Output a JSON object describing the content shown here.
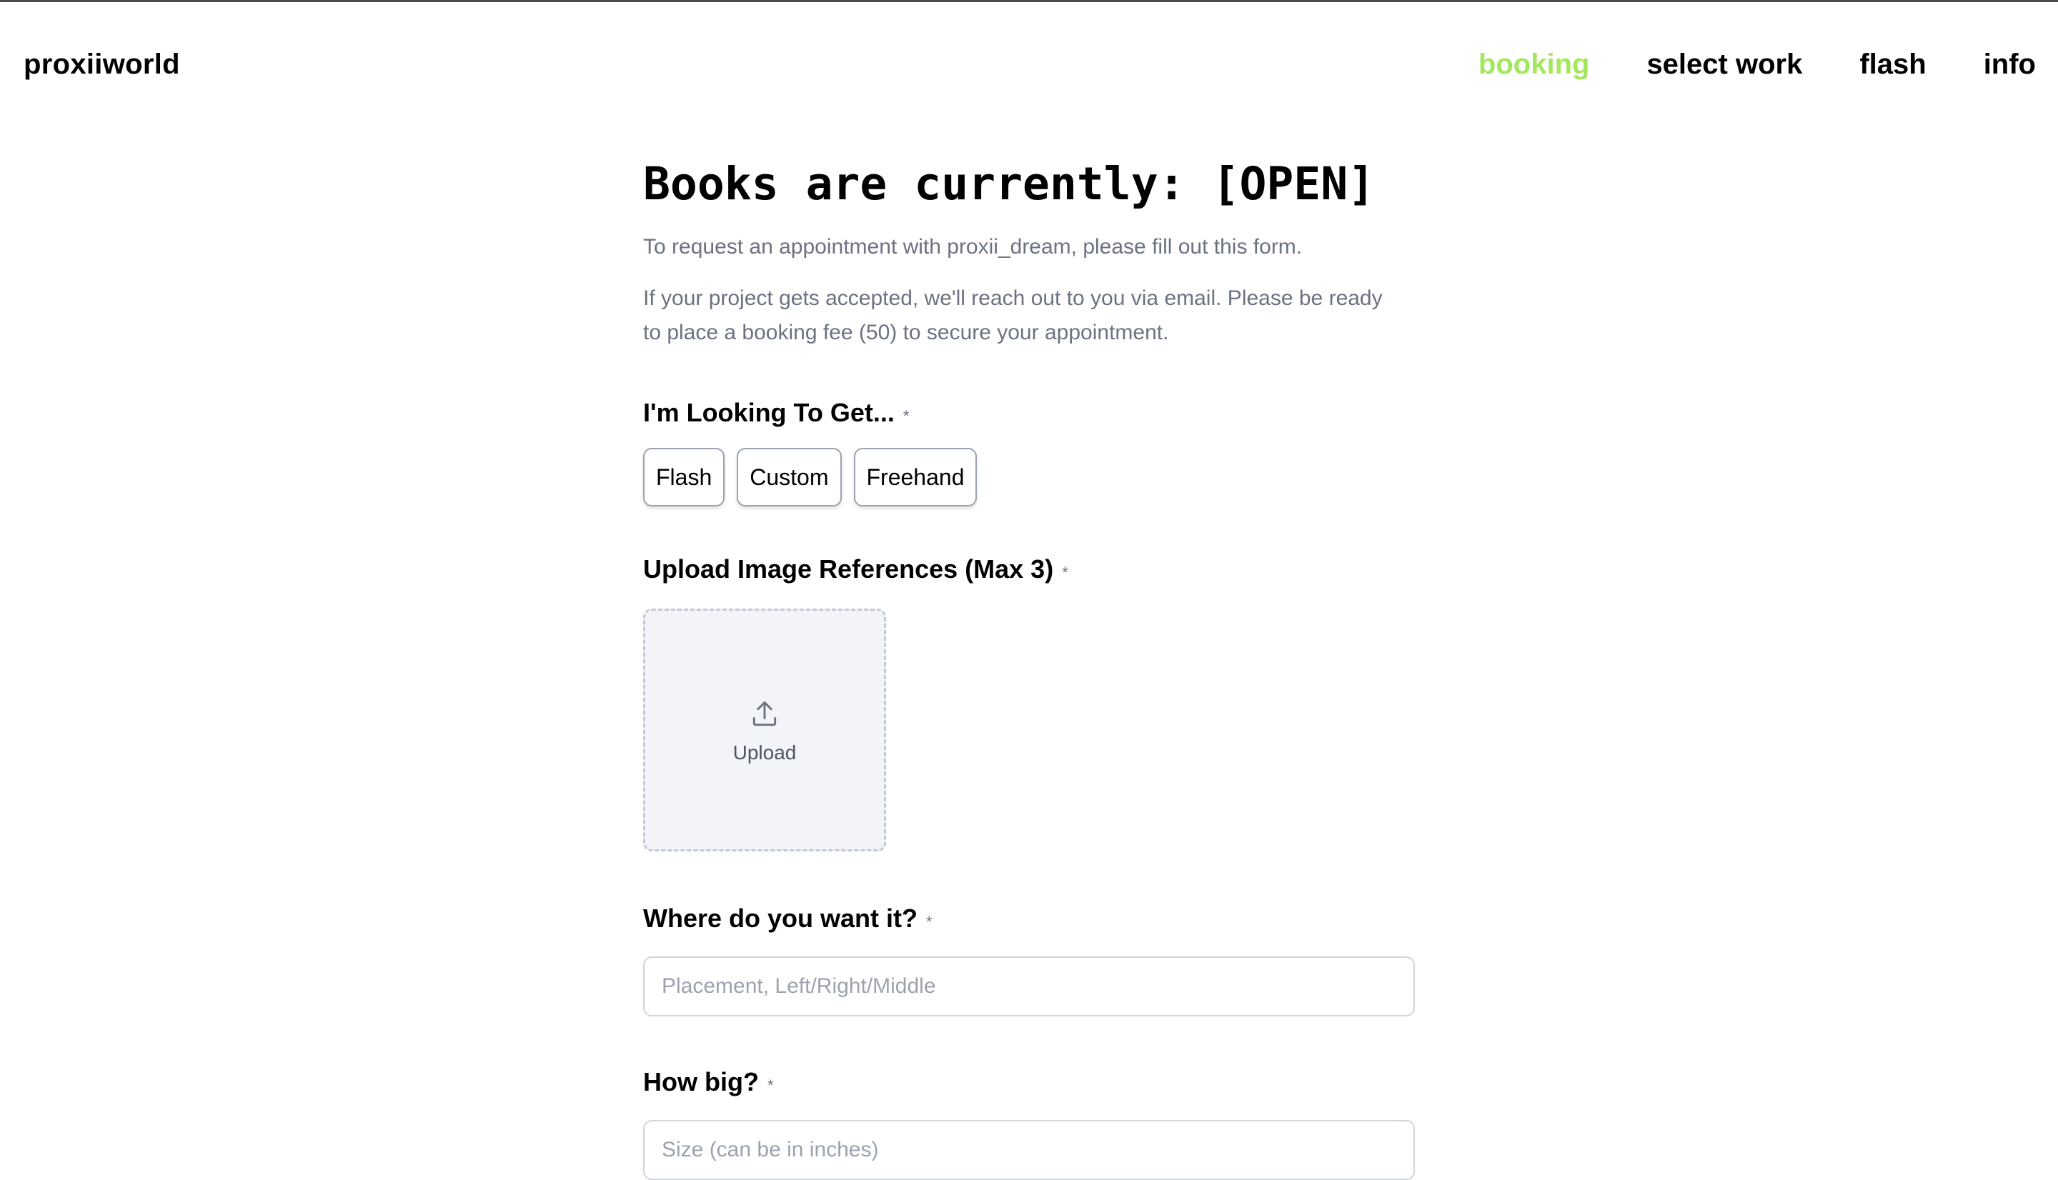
{
  "header": {
    "brand": "proxiiworld",
    "nav": [
      {
        "label": "booking",
        "active": true
      },
      {
        "label": "select work",
        "active": false
      },
      {
        "label": "flash",
        "active": false
      },
      {
        "label": "info",
        "active": false
      }
    ]
  },
  "main": {
    "headline": "Books are currently: [OPEN]",
    "intro_1": "To request an appointment with proxii_dream, please fill out this form.",
    "intro_2": "If your project gets accepted, we'll reach out to you via email. Please be ready to place a booking fee (50) to secure your appointment.",
    "looking": {
      "label": "I'm Looking To Get...",
      "required": "*",
      "options": [
        "Flash",
        "Custom",
        "Freehand"
      ]
    },
    "upload": {
      "label": "Upload Image References (Max 3)",
      "required": "*",
      "icon": "upload-icon",
      "button_text": "Upload"
    },
    "placement": {
      "label": "Where do you want it?",
      "required": "*",
      "placeholder": "Placement, Left/Right/Middle",
      "value": ""
    },
    "size": {
      "label": "How big?",
      "required": "*",
      "placeholder": "Size (can be in inches)",
      "value": ""
    }
  },
  "colors": {
    "accent_active_nav": "#a3e85c",
    "muted_text": "#6b7280",
    "upload_bg": "#f2f4f8"
  }
}
